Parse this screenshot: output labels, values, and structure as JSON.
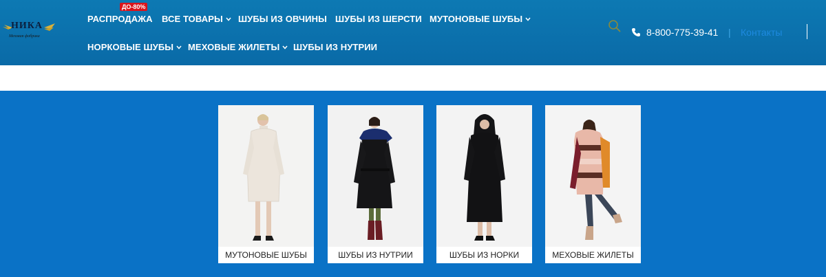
{
  "logo": {
    "name": "НИКА",
    "tagline": "Меховая фабрика"
  },
  "nav": {
    "row1": [
      {
        "label": "РАСПРОДАЖА",
        "dropdown": false
      },
      {
        "label": "ВСЕ ТОВАРЫ",
        "dropdown": true
      },
      {
        "label": "ШУБЫ ИЗ ОВЧИНЫ",
        "dropdown": false
      },
      {
        "label": "ШУБЫ ИЗ ШЕРСТИ",
        "dropdown": false
      },
      {
        "label": "МУТОНОВЫЕ ШУБЫ",
        "dropdown": true
      }
    ],
    "row2": [
      {
        "label": "НОРКОВЫЕ ШУБЫ",
        "dropdown": true
      },
      {
        "label": "МЕХОВЫЕ ЖИЛЕТЫ",
        "dropdown": true
      },
      {
        "label": "ШУБЫ ИЗ НУТРИИ",
        "dropdown": false
      }
    ],
    "sale_badge": "ДО-80%"
  },
  "header_right": {
    "search_icon": "search-icon",
    "phone_icon": "phone-icon",
    "phone": "8-800-775-39-41",
    "separator": "|",
    "contacts": "Контакты"
  },
  "categories": [
    {
      "label": "МУТОНОВЫЕ ШУБЫ",
      "coat_color": "#eae3da"
    },
    {
      "label": "ШУБЫ ИЗ НУТРИИ",
      "coat_color": "#141416"
    },
    {
      "label": "ШУБЫ ИЗ НОРКИ",
      "coat_color": "#111113"
    },
    {
      "label": "МЕХОВЫЕ ЖИЛЕТЫ",
      "coat_color": "#e7b7a8"
    }
  ],
  "colors": {
    "header": "#0b70ad",
    "body_bg": "#0a72c6",
    "sale_badge": "#d9151c",
    "contacts_link": "#1e8ae0"
  }
}
